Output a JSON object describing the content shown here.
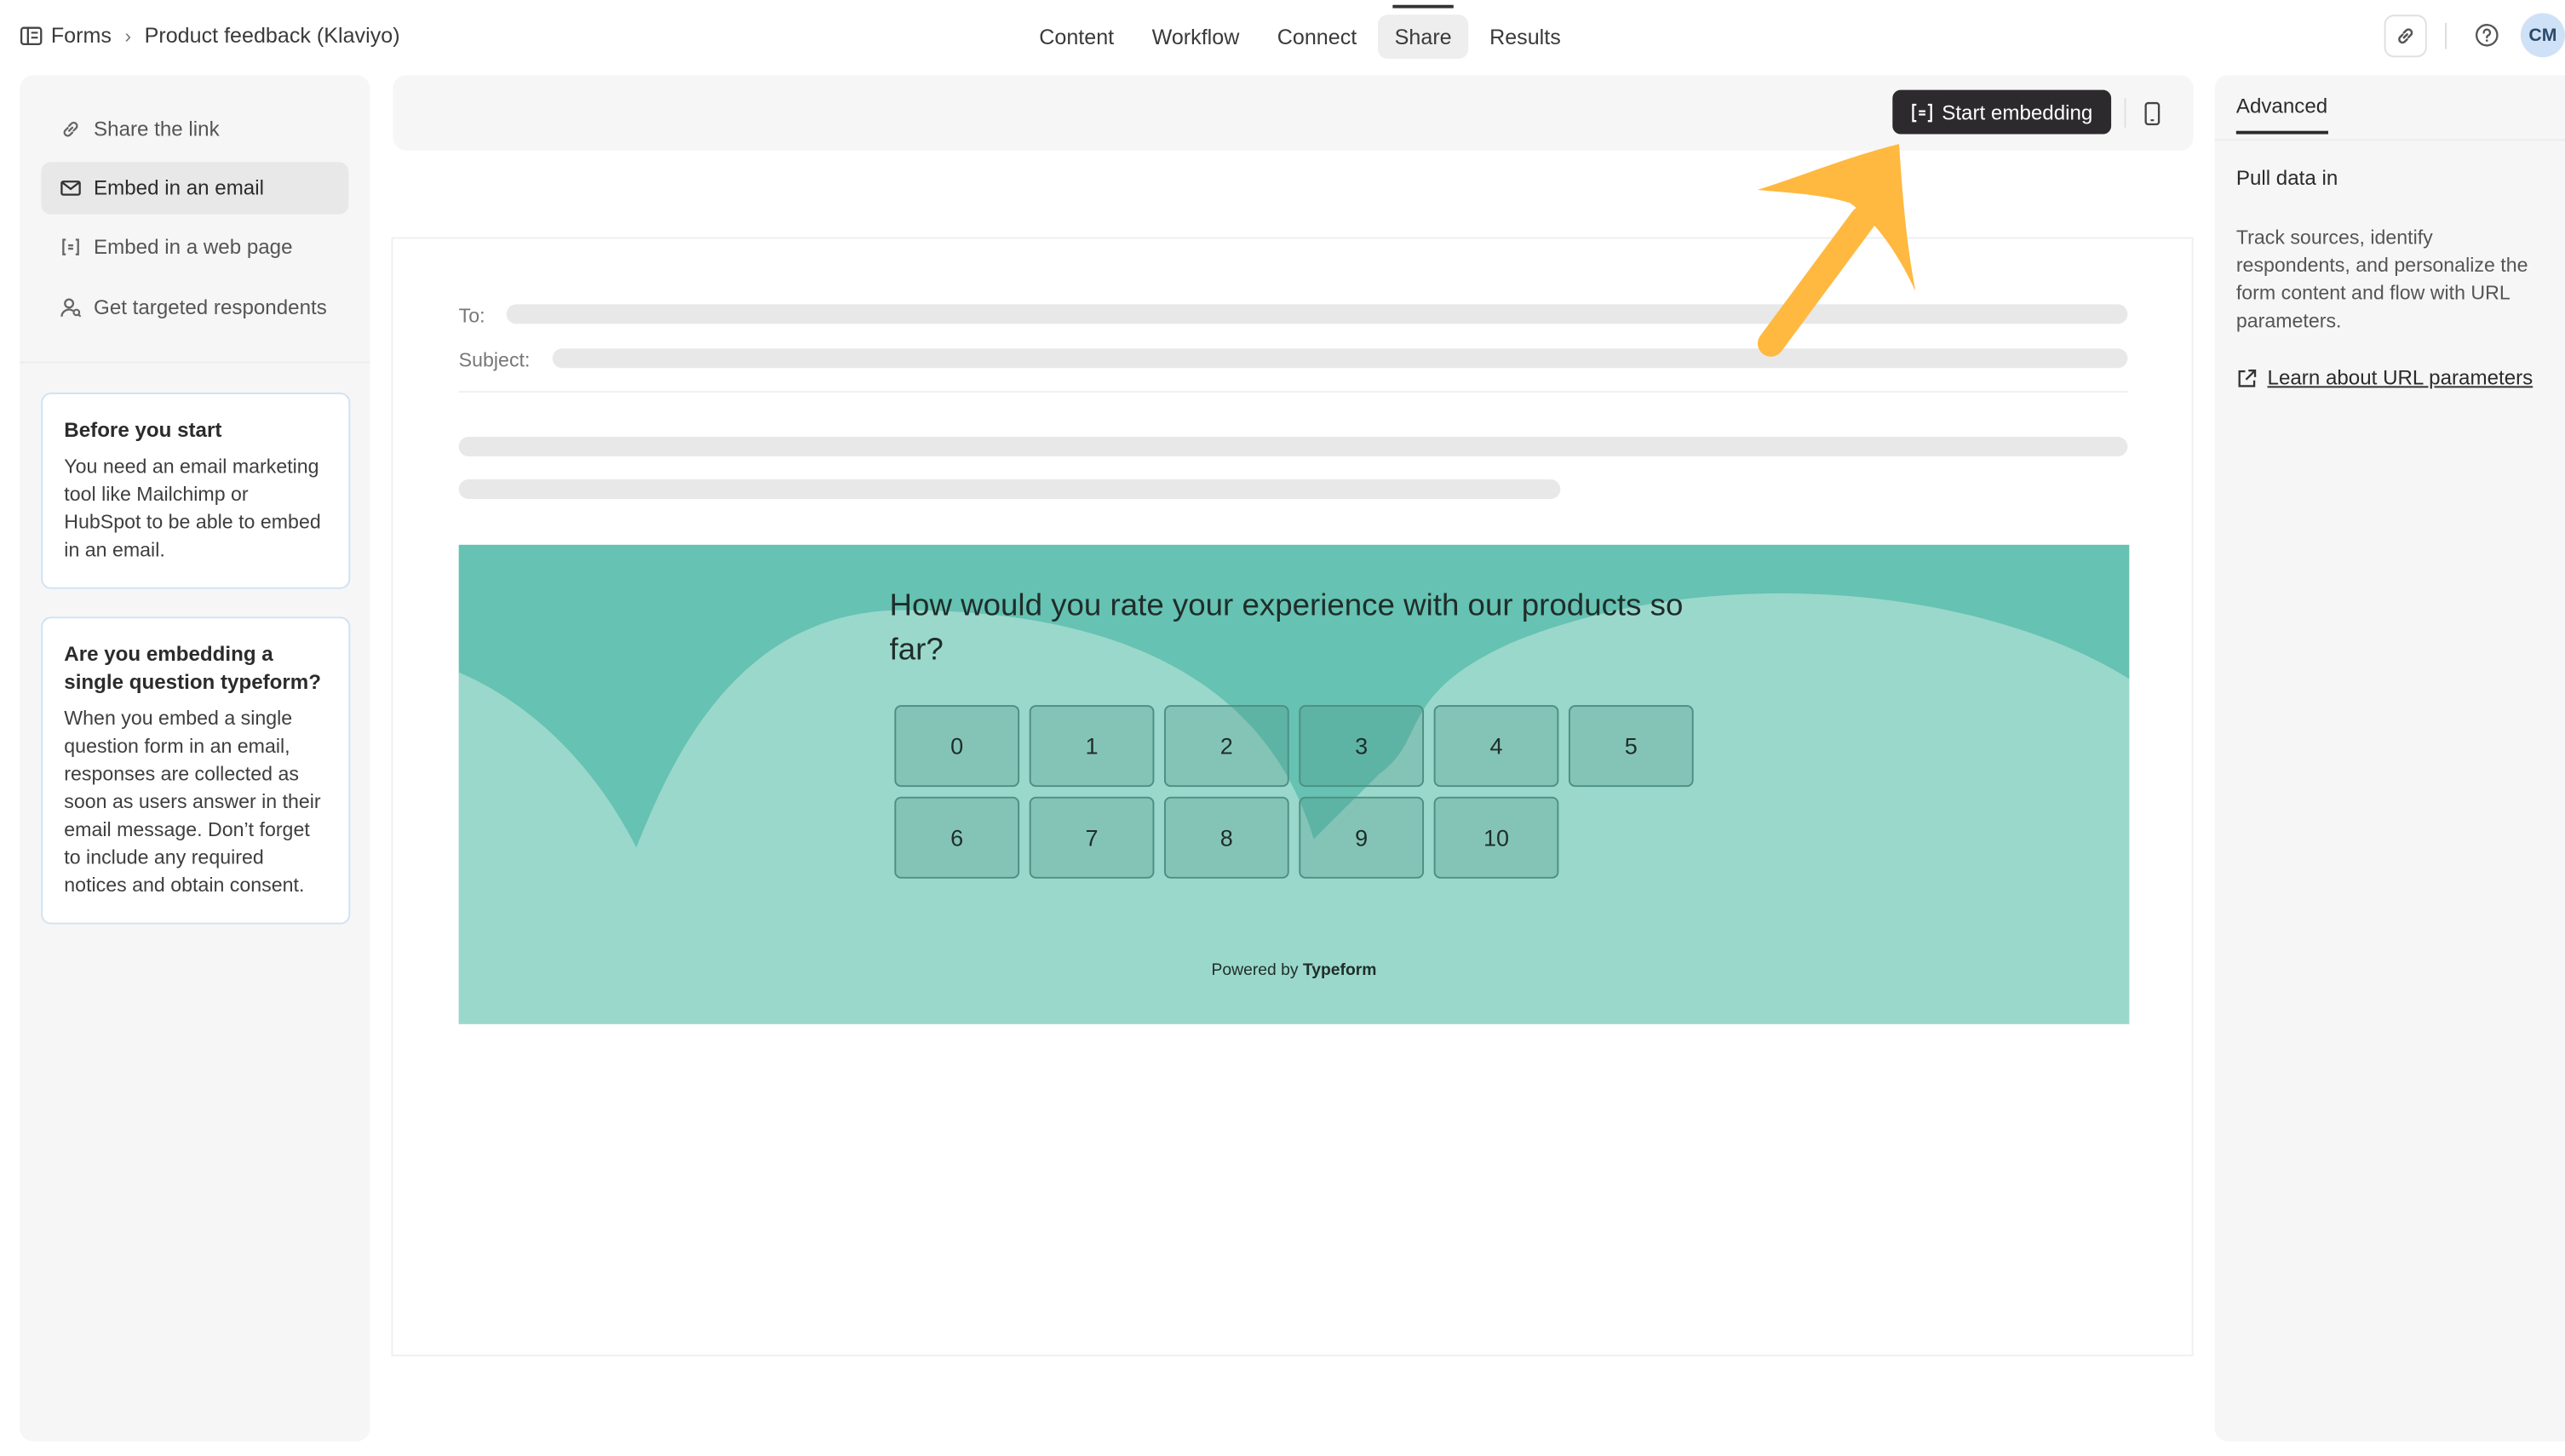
{
  "header": {
    "breadcrumb_root": "Forms",
    "breadcrumb_form": "Product feedback (Klaviyo)",
    "tabs": [
      "Content",
      "Workflow",
      "Connect",
      "Share",
      "Results"
    ],
    "active_tab": "Share",
    "avatar_initials": "CM"
  },
  "sidebar": {
    "items": [
      {
        "label": "Share the link",
        "icon": "link-icon"
      },
      {
        "label": "Embed in an email",
        "icon": "mail-icon"
      },
      {
        "label": "Embed in a web page",
        "icon": "embed-code-icon"
      },
      {
        "label": "Get targeted respondents",
        "icon": "person-search-icon"
      }
    ],
    "active_item": "Embed in an email",
    "card1": {
      "title": "Before you start",
      "text": "You need an email marketing tool like Mailchimp or HubSpot to be able to embed in an email."
    },
    "card2": {
      "title": "Are you embedding a single question typeform?",
      "text": "When you embed a single question form in an email, responses are collected as soon as users answer in their email message. Don’t forget to include any required notices and obtain consent."
    }
  },
  "toolbar": {
    "start_label": "Start embedding"
  },
  "preview": {
    "to_label": "To:",
    "subject_label": "Subject:",
    "question": "How would you rate your experience with our products so far?",
    "ratings": [
      "0",
      "1",
      "2",
      "3",
      "4",
      "5",
      "6",
      "7",
      "8",
      "9",
      "10"
    ],
    "powered_prefix": "Powered by",
    "powered_brand": "Typeform"
  },
  "right_panel": {
    "tab": "Advanced",
    "heading": "Pull data in",
    "text": "Track sources, identify respondents, and personalize the form content and flow with URL parameters.",
    "link": "Learn about URL parameters"
  },
  "colors": {
    "accent_dark": "#2d2a2e",
    "embed_bg": "#9ad8cb",
    "embed_wave": "#66c2b2",
    "arrow": "#ffb940",
    "card_border": "#cfe2f4"
  }
}
